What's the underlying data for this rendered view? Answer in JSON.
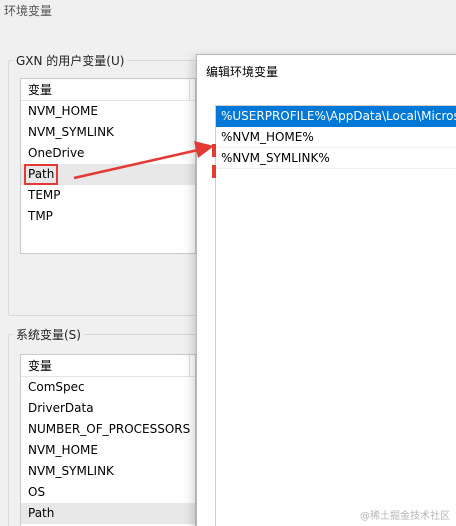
{
  "window": {
    "title": "环境变量"
  },
  "user_vars": {
    "group_label": "GXN 的用户变量(U)",
    "header": "变量",
    "rows": [
      "NVM_HOME",
      "NVM_SYMLINK",
      "OneDrive",
      "Path",
      "TEMP",
      "TMP"
    ],
    "selected": "Path"
  },
  "system_vars": {
    "group_label": "系统变量(S)",
    "header": "变量",
    "rows": [
      "ComSpec",
      "DriverData",
      "NUMBER_OF_PROCESSORS",
      "NVM_HOME",
      "NVM_SYMLINK",
      "OS",
      "Path"
    ],
    "selected": "Path"
  },
  "dialog": {
    "title": "编辑环境变量",
    "entries": [
      "%USERPROFILE%\\AppData\\Local\\Micros",
      "%NVM_HOME%",
      "%NVM_SYMLINK%"
    ],
    "selected_index": 0
  },
  "annotation": {
    "color": "#e53935"
  },
  "accent_color": "#0078d7",
  "watermark": "@稀土掘金技术社区"
}
